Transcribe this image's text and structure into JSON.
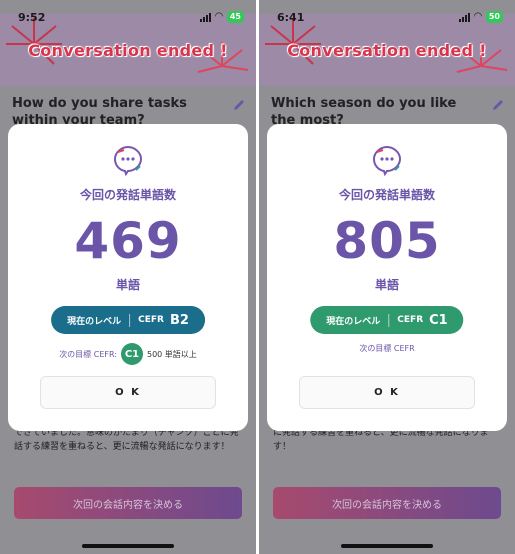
{
  "screens": [
    {
      "status": {
        "time": "9:52",
        "battery": "45"
      },
      "banner_title": "Conversation ended !",
      "question": "How do you share tasks within your team?",
      "background_text": "できていました。意味のかたまり（チャンク）ごとに発話する練習を重ねると、更に流暢な発話になります！",
      "cta_label": "次回の会話内容を決める",
      "modal": {
        "title": "今回の発話単語数",
        "word_count": "469",
        "unit": "単語",
        "level_label": "現在のレベル",
        "cefr_label": "CEFR",
        "level": "B2",
        "level_color": "#1a6e8c",
        "next_goal_label": "次の目標 CEFR:",
        "next_goal_level": "C1",
        "next_goal_words": "500 単語以上",
        "ok_label": "O K"
      }
    },
    {
      "status": {
        "time": "6:41",
        "battery": "50"
      },
      "banner_title": "Conversation ended !",
      "question": "Which season do you like the most?",
      "background_text": "に発話する練習を重ねると、更に流暢な発話になります！",
      "cta_label": "次回の会話内容を決める",
      "modal": {
        "title": "今回の発話単語数",
        "word_count": "805",
        "unit": "単語",
        "level_label": "現在のレベル",
        "cefr_label": "CEFR",
        "level": "C1",
        "level_color": "#2f9a6e",
        "next_goal_label": "次の目標 CEFR",
        "ok_label": "O K"
      }
    }
  ],
  "icons": {
    "edit": "pencil-icon",
    "logo": "app-logo-icon",
    "signal": "signal-bars-icon",
    "wifi": "wifi-icon"
  }
}
